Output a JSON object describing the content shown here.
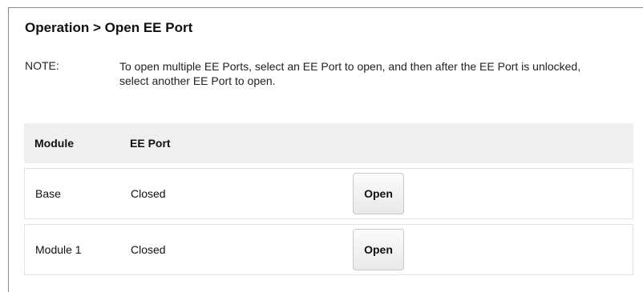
{
  "page": {
    "title": "Operation > Open EE Port"
  },
  "note": {
    "label": "NOTE:",
    "text": "To open multiple EE Ports, select an EE Port to open, and then after the EE Port is unlocked, select another EE Port to open."
  },
  "table": {
    "headers": {
      "module": "Module",
      "ee_port": "EE Port"
    },
    "rows": [
      {
        "module": "Base",
        "ee_port": "Closed",
        "action": "Open"
      },
      {
        "module": "Module 1",
        "ee_port": "Closed",
        "action": "Open"
      }
    ]
  }
}
